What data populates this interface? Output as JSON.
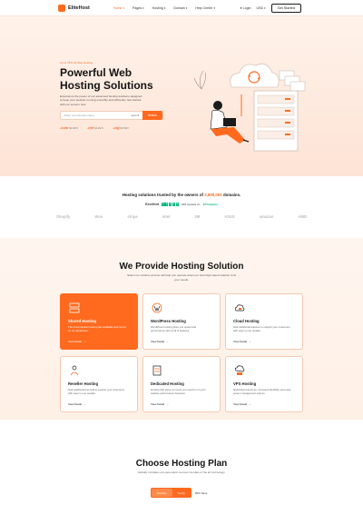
{
  "header": {
    "brand": "EliteHost",
    "nav": [
      {
        "label": "Home",
        "active": true
      },
      {
        "label": "Pages",
        "active": false
      },
      {
        "label": "Hosting",
        "active": false
      },
      {
        "label": "Domain",
        "active": false
      },
      {
        "label": "Help Center",
        "active": false
      }
    ],
    "login": "Login",
    "currency": "USD",
    "cta": "Get Started"
  },
  "hero": {
    "pill": "Up to 75% off Web Hosting",
    "title_line1": "Powerful Web",
    "title_line2": "Hosting Solutions",
    "description": "Experience the power of our advanced hosting solutions designed to keep your website running smoothly and efficiently. Get started with our servers now.",
    "domain_placeholder": "Enter your domain name",
    "domain_tld": ".com",
    "domain_button": "Search",
    "tlds": [
      {
        "name": ".com",
        "price": "$2.99/Yr"
      },
      {
        "name": ".net",
        "price": "$4.99/Yr"
      },
      {
        "name": ".org",
        "price": "$3.99/Yr"
      }
    ]
  },
  "trusted": {
    "title_prefix": "Hosting solutions trusted by the owners of",
    "title_highlight": "2,800,000",
    "title_suffix": "domains.",
    "excellent": "Excellent",
    "reviews": "904 reviews on",
    "trustpilot": "Trustpilot",
    "brands": [
      "Shopify",
      "Woo",
      "stripe",
      "intel",
      "3M",
      "ASUS",
      "amazon",
      "AMD"
    ]
  },
  "services": {
    "title": "We Provide Hosting Solution",
    "subtitle": "Select our solution and we will help you operate down our best high speed solution to fit your needs.",
    "cards": [
      {
        "title": "Shared Hosting",
        "desc": "The most popular hosting plan available and comes on our all devices.",
        "link": "View Detail",
        "active": true,
        "icon": "shared-hosting-icon"
      },
      {
        "title": "WordPress Hosting",
        "desc": "WordPress hosting gives you speed and performance with a full of features.",
        "link": "View Detail",
        "active": false,
        "icon": "wordpress-icon"
      },
      {
        "title": "Cloud Hosting",
        "desc": "Gain additional features to support your customers with easy to use reseller.",
        "link": "View Detail",
        "active": false,
        "icon": "cloud-hosting-icon"
      },
      {
        "title": "Reseller Hosting",
        "desc": "Gain additional innovative support your customers with easy to use reseller.",
        "link": "View Detail",
        "active": false,
        "icon": "reseller-icon"
      },
      {
        "title": "Dedicated Hosting",
        "desc": "Hosting that gives you tools you need to run your website performance business.",
        "link": "View Detail",
        "active": false,
        "icon": "dedicated-server-icon"
      },
      {
        "title": "VPS Hosting",
        "desc": "Dedicated resources, increased flexibility, and easy server management options.",
        "link": "View Detail",
        "active": false,
        "icon": "vps-hosting-icon"
      }
    ]
  },
  "plans": {
    "title": "Choose Hosting Plan",
    "subtitle": "Globally incubate next-generation sources via state of the art technology.",
    "toggle": [
      "Monthly",
      "Yearly"
    ],
    "save": "30% Save"
  },
  "colors": {
    "accent": "#ff6a1f",
    "hero_bg": "#fde3d5"
  }
}
